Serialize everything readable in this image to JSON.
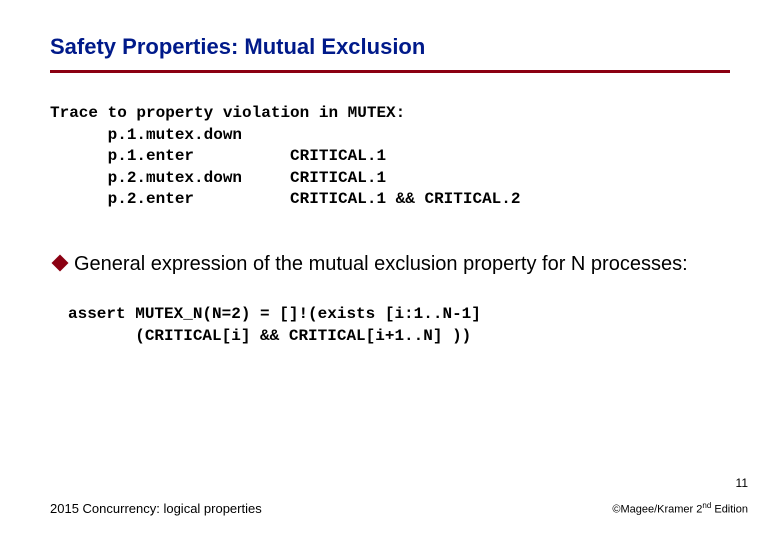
{
  "title": "Safety Properties: Mutual Exclusion",
  "trace": "Trace to property violation in MUTEX:\n      p.1.mutex.down\n      p.1.enter          CRITICAL.1\n      p.2.mutex.down     CRITICAL.1\n      p.2.enter          CRITICAL.1 && CRITICAL.2",
  "bullet": "General expression of the mutual exclusion property for N processes:",
  "assert": "assert MUTEX_N(N=2) = []!(exists [i:1..N-1]\n       (CRITICAL[i] && CRITICAL[i+1..N] ))",
  "pagenum": "11",
  "footer_left": "2015 Concurrency: logical properties",
  "footer_right_prefix": "©Magee/Kramer 2",
  "footer_right_sup": "nd",
  "footer_right_suffix": " Edition"
}
